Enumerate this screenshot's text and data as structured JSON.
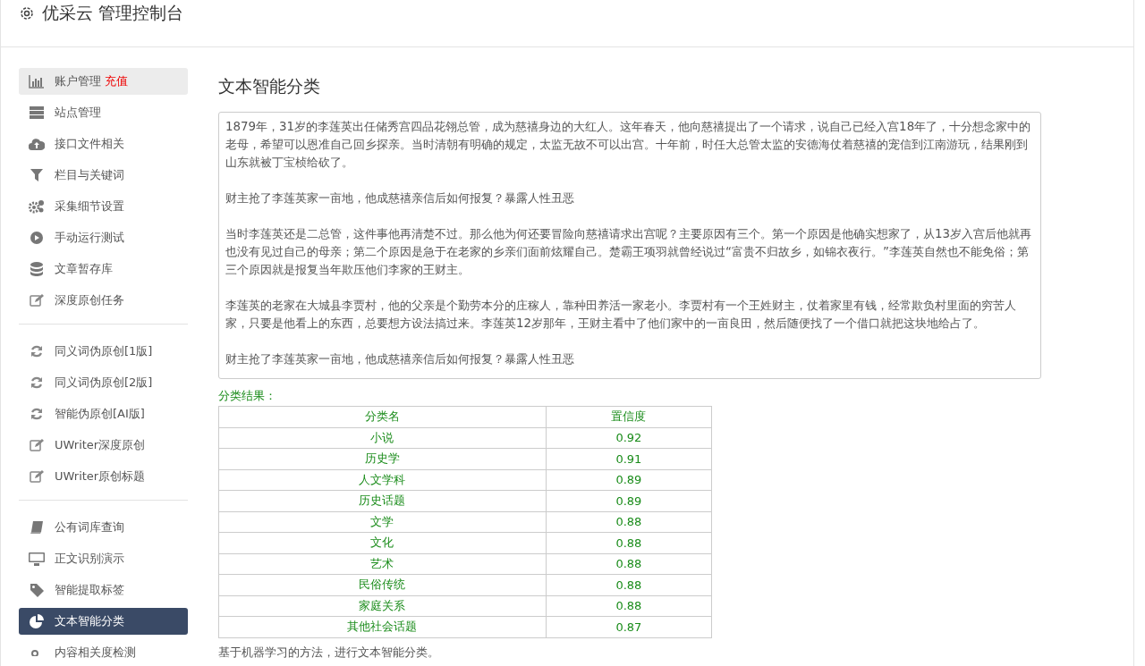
{
  "header": {
    "title": "优采云 管理控制台"
  },
  "sidebar": {
    "groups": [
      {
        "items": [
          {
            "label": "账户管理",
            "badge": "充值",
            "selected": false,
            "hovered": true
          },
          {
            "label": "站点管理",
            "selected": false,
            "hovered": false
          },
          {
            "label": "接口文件相关",
            "selected": false,
            "hovered": false
          },
          {
            "label": "栏目与关键词",
            "selected": false,
            "hovered": false
          },
          {
            "label": "采集细节设置",
            "selected": false,
            "hovered": false
          },
          {
            "label": "手动运行测试",
            "selected": false,
            "hovered": false
          },
          {
            "label": "文章暂存库",
            "selected": false,
            "hovered": false
          },
          {
            "label": "深度原创任务",
            "selected": false,
            "hovered": false
          }
        ]
      },
      {
        "items": [
          {
            "label": "同义词伪原创[1版]",
            "selected": false,
            "hovered": false
          },
          {
            "label": "同义词伪原创[2版]",
            "selected": false,
            "hovered": false
          },
          {
            "label": "智能伪原创[AI版]",
            "selected": false,
            "hovered": false
          },
          {
            "label": "UWriter深度原创",
            "selected": false,
            "hovered": false
          },
          {
            "label": "UWriter原创标题",
            "selected": false,
            "hovered": false
          }
        ]
      },
      {
        "items": [
          {
            "label": "公有词库查询",
            "selected": false,
            "hovered": false
          },
          {
            "label": "正文识别演示",
            "selected": false,
            "hovered": false
          },
          {
            "label": "智能提取标签",
            "selected": false,
            "hovered": false
          },
          {
            "label": "文本智能分类",
            "selected": true,
            "hovered": false
          },
          {
            "label": "内容相关度检测",
            "selected": false,
            "hovered": false
          }
        ]
      }
    ]
  },
  "main": {
    "title": "文本智能分类",
    "text_input": {
      "value": [
        "1879年，31岁的李莲英出任储秀宫四品花翎总管，成为慈禧身边的大红人。这年春天，他向慈禧提出了一个请求，说自己已经入宫18年了，十分想念家中的老母，希望可以恩准自己回乡探亲。当时清朝有明确的规定，太监无故不可以出宫。十年前，时任大总管太监的安德海仗着慈禧的宠信到江南游玩，结果刚到山东就被丁宝桢给砍了。",
        "财主抢了李莲英家一亩地，他成慈禧亲信后如何报复？暴露人性丑恶",
        "当时李莲英还是二总管，这件事他再清楚不过。那么他为何还要冒险向慈禧请求出宫呢？主要原因有三个。第一个原因是他确实想家了，从13岁入宫后他就再也没有见过自己的母亲；第二个原因是急于在老家的乡亲们面前炫耀自己。楚霸王项羽就曾经说过“富贵不归故乡，如锦衣夜行。”李莲英自然也不能免俗；第三个原因就是报复当年欺压他们李家的王财主。",
        "李莲英的老家在大城县李贾村，他的父亲是个勤劳本分的庄稼人，靠种田养活一家老小。李贾村有一个王姓财主，仗着家里有钱，经常欺负村里面的穷苦人家，只要是他看上的东西，总要想方设法搞过来。李莲英12岁那年，王财主看中了他们家中的一亩良田，然后随便找了一个借口就把这块地给占了。",
        "财主抢了李莲英家一亩地，他成慈禧亲信后如何报复？暴露人性丑恶"
      ]
    },
    "result_label": "分类结果：",
    "table": {
      "columns": [
        "分类名",
        "置信度"
      ],
      "rows": [
        [
          "小说",
          "0.92"
        ],
        [
          "历史学",
          "0.91"
        ],
        [
          "人文学科",
          "0.89"
        ],
        [
          "历史话题",
          "0.89"
        ],
        [
          "文学",
          "0.88"
        ],
        [
          "文化",
          "0.88"
        ],
        [
          "艺术",
          "0.88"
        ],
        [
          "民俗传统",
          "0.88"
        ],
        [
          "家庭关系",
          "0.88"
        ],
        [
          "其他社会话题",
          "0.87"
        ]
      ]
    },
    "note": "基于机器学习的方法，进行文本智能分类。"
  }
}
